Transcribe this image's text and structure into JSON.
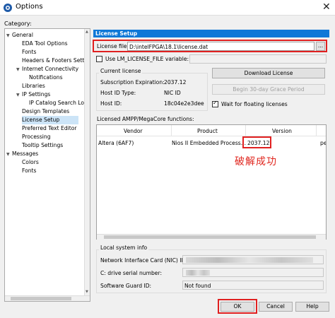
{
  "window": {
    "title": "Options",
    "close_glyph": "✕"
  },
  "category_label": "Category:",
  "tree": [
    {
      "label": "General",
      "expanded": true
    },
    {
      "label": "EDA Tool Options"
    },
    {
      "label": "Fonts"
    },
    {
      "label": "Headers & Footers Setting"
    },
    {
      "label": "Internet Connectivity",
      "expanded": true
    },
    {
      "label": "Notifications"
    },
    {
      "label": "Libraries"
    },
    {
      "label": "IP Settings",
      "expanded": true
    },
    {
      "label": "IP Catalog Search Locat"
    },
    {
      "label": "Design Templates"
    },
    {
      "label": "License Setup",
      "selected": true
    },
    {
      "label": "Preferred Text Editor"
    },
    {
      "label": "Processing"
    },
    {
      "label": "Tooltip Settings"
    },
    {
      "label": "Messages",
      "expanded": true
    },
    {
      "label": "Colors"
    },
    {
      "label": "Fonts"
    }
  ],
  "panel": {
    "header": "License Setup",
    "license_file_label": "License file:",
    "license_file_value": "D:\\intelFPGA\\18.1\\license.dat",
    "browse_label": "...",
    "use_lm_label": "Use LM_LICENSE_FILE variable:",
    "current_license_label": "Current license",
    "sub_exp_label": "Subscription Expiration:",
    "sub_exp_value": "2037.12",
    "host_type_label": "Host ID Type:",
    "host_type_value": "NIC ID",
    "host_id_label": "Host ID:",
    "host_id_value": "18c04e2e3dee",
    "download_label": "Download License",
    "grace_label": "Begin 30-day Grace Period",
    "wait_label": "Wait for floating licenses",
    "licensed_label": "Licensed AMPP/MegaCore functions:",
    "table": {
      "headers": [
        "Vendor",
        "Product",
        "Version"
      ],
      "rows": [
        {
          "vendor": "Altera (6AF7)",
          "product": "Nios II Embedded Process...",
          "version": "2037.12",
          "extra": "pe"
        }
      ]
    },
    "crack_text": "破解成功",
    "local_info_label": "Local system info",
    "nic_label": "Network Interface Card (NIC) ID:",
    "cdrive_label": "C: drive serial number:",
    "guard_label": "Software Guard ID:",
    "guard_value": "Not found"
  },
  "buttons": {
    "ok": "OK",
    "cancel": "Cancel",
    "help": "Help"
  },
  "colors": {
    "accent": "#0e78d7",
    "highlight": "#e02020",
    "annotation": "#e0261e"
  }
}
